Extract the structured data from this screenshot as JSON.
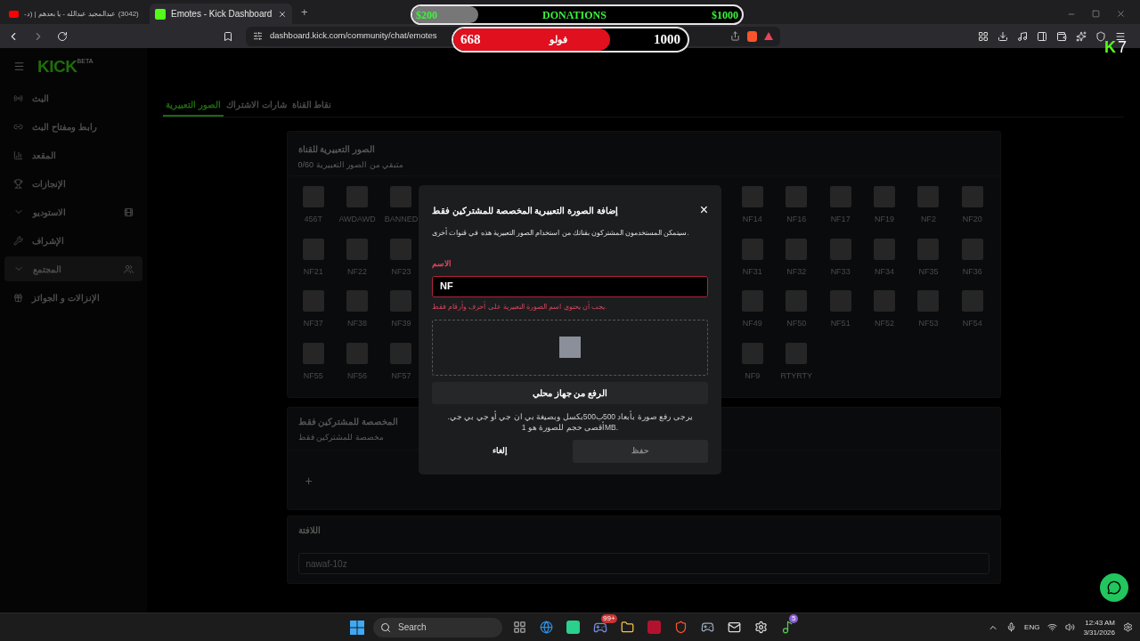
{
  "browser": {
    "first_tab": {
      "title": "(3042) عبدالمجيد عبدالله - يا بعدهم | (د-",
      "selected": false
    },
    "second_tab": {
      "title": "Emotes - Kick Dashboard",
      "selected": true
    },
    "new_tab": "+",
    "url": "dashboard.kick.com/community/chat/emotes"
  },
  "stream_overlay": {
    "donations": {
      "min": "$200",
      "label": "DONATIONS",
      "max": "$1000",
      "level": 0.2
    },
    "follows": {
      "current": "668",
      "label": "فولو",
      "goal": "1000",
      "level": 0.67
    },
    "corner_badge": {
      "letter": "K",
      "count": "7"
    }
  },
  "logo": {
    "text": "KICK",
    "tag": "BETA"
  },
  "sidebar": {
    "items": [
      {
        "label": "البث",
        "expandable": false,
        "selected": false
      },
      {
        "label": "رابط ومفتاح البث",
        "expandable": false,
        "selected": false
      },
      {
        "label": "المقعد",
        "expandable": false,
        "selected": false
      },
      {
        "label": "الإنجازات",
        "expandable": false,
        "selected": false
      },
      {
        "label": "الاستوديو",
        "expandable": true,
        "selected": false
      },
      {
        "label": "الإشراف",
        "expandable": false,
        "selected": false
      },
      {
        "label": "المجتمع",
        "expandable": true,
        "selected": true
      },
      {
        "label": "الإنزالات و الجوائز",
        "expandable": false,
        "selected": false
      }
    ]
  },
  "tabs": [
    {
      "label": "نقاط القناة",
      "selected": false
    },
    {
      "label": "شارات الاشتراك",
      "selected": false
    },
    {
      "label": "الصور التعبيرية",
      "selected": true
    }
  ],
  "channel_emotes": {
    "title": "الصور التعبيرية للقناة",
    "subtitle": "0/60 متبقي من الصور التعبيرية",
    "rows": [
      {
        "right": [
          "NF20",
          "NF2",
          "NF19",
          "NF17",
          "NF16",
          "NF14"
        ],
        "left": [
          "BANNED",
          "AWDAWD",
          "456T"
        ]
      },
      {
        "right": [
          "NF36",
          "NF35",
          "NF34",
          "NF33",
          "NF32",
          "NF31"
        ],
        "left": [
          "NF23",
          "NF22",
          "NF21"
        ]
      },
      {
        "right": [
          "NF54",
          "NF53",
          "NF52",
          "NF51",
          "NF50",
          "NF49"
        ],
        "left": [
          "NF39",
          "NF38",
          "NF37"
        ]
      },
      {
        "right": [
          "RTYRTY",
          "NF9"
        ],
        "left": [
          "NF57",
          "NF56",
          "NF55"
        ]
      }
    ]
  },
  "subscriber_emotes": {
    "title": "المخصصة للمشتركين فقط",
    "subtitle": "مخصصة للمشتركين فقط",
    "add": "+"
  },
  "banner": {
    "title": "اللافتة",
    "value": "nawaf-10z"
  },
  "dialog": {
    "title": "إضافة الصورة التعبيرية المخصصة للمشتركين فقط",
    "close": "×",
    "description": "سيتمكن المستخدمون المشتركون بقناتك من استخدام الصور التعبيرية هذه في قنوات أخرى.",
    "name_label": "الاسم",
    "name_value": "NF",
    "invalid": true,
    "error": "يجب أن يحتوي اسم الصورة التعبيرية على أحرف وأرقام فقط.",
    "upload": "الرفع من جهاز محلي",
    "help": "يرجى رفع صورة بأبعاد 500ب500بكسل وبصيغة بي ان جي أو جي بي جي. أقصى حجم للصورة هو 1MB.",
    "cancel": "إلغاء",
    "save": "حفظ",
    "save_disabled": true
  },
  "taskbar": {
    "search_placeholder": "Search",
    "game_chat_badge": "99+",
    "music_badge": "5",
    "language": "ENG",
    "time": "12:43 AM",
    "date": "3/31/2026"
  }
}
